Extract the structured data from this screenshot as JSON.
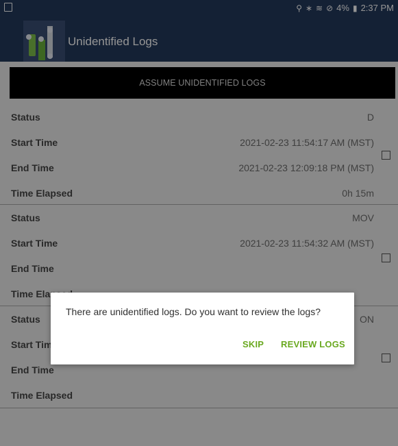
{
  "status_bar": {
    "time": "2:37 PM",
    "battery": "4%",
    "icons": [
      "location-icon",
      "bluetooth-icon",
      "wifi-icon",
      "no-signal-icon",
      "battery-icon",
      "screenshot-icon"
    ]
  },
  "app_bar": {
    "title": "Unidentified Logs"
  },
  "assume_button": "ASSUME UNIDENTIFIED LOGS",
  "logs": [
    {
      "status_label": "Status",
      "status": "D",
      "start_label": "Start Time",
      "start": "2021-02-23 11:54:17 AM (MST)",
      "end_label": "End Time",
      "end": "2021-02-23 12:09:18 PM (MST)",
      "elapsed_label": "Time Elapsed",
      "elapsed": "0h 15m"
    },
    {
      "status_label": "Status",
      "status": "MOV",
      "start_label": "Start Time",
      "start": "2021-02-23 11:54:32 AM (MST)",
      "end_label": "End Time",
      "end": "",
      "elapsed_label": "Time Elapsed",
      "elapsed": ""
    },
    {
      "status_label": "Status",
      "status": "ON",
      "start_label": "Start Time",
      "start": "",
      "end_label": "End Time",
      "end": "",
      "elapsed_label": "Time Elapsed",
      "elapsed": ""
    }
  ],
  "dialog": {
    "message": "There are unidentified logs. Do you want to review the logs?",
    "skip": "SKIP",
    "review": "REVIEW LOGS"
  },
  "colors": {
    "app_bar": "#24395c",
    "accent_green": "#6aa920",
    "assume_button": "#000000"
  }
}
